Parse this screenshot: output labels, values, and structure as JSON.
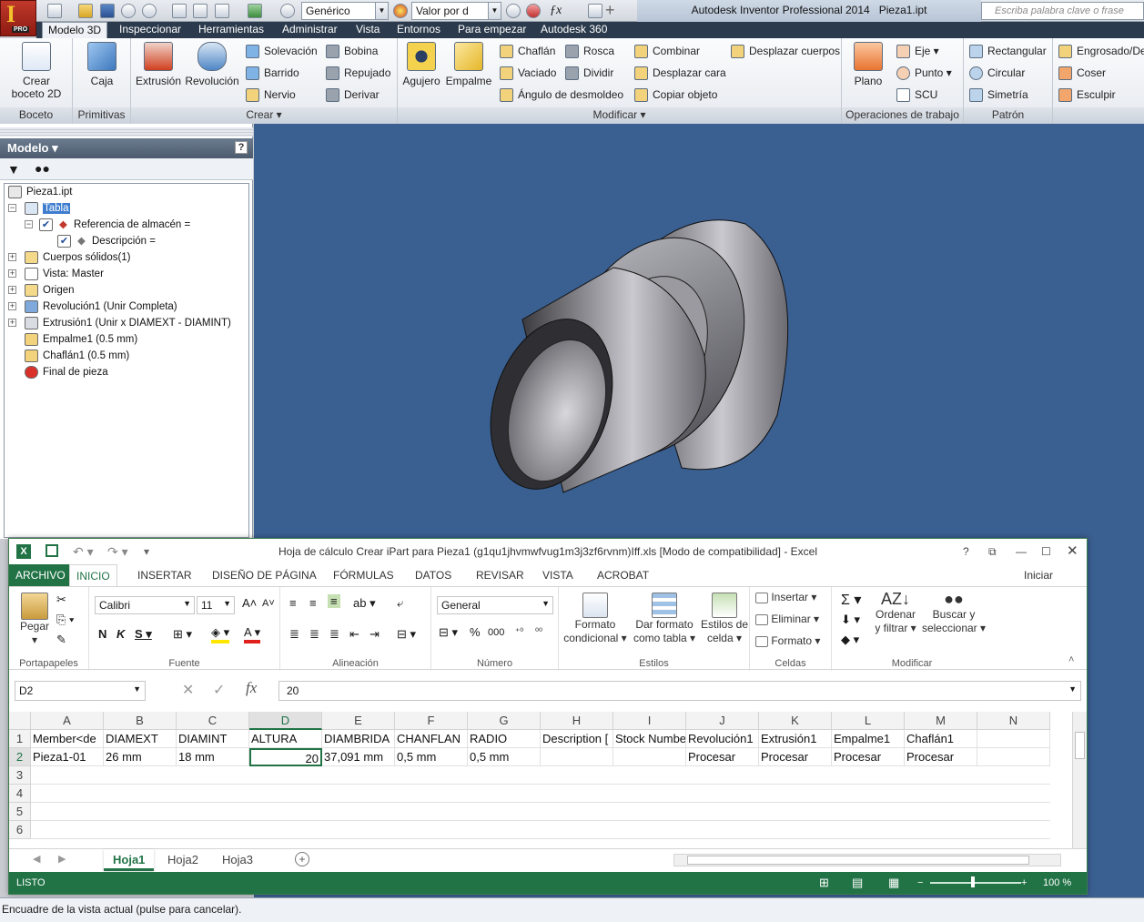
{
  "app": {
    "title": "Autodesk Inventor Professional 2014",
    "document": "Pieza1.ipt",
    "help_placeholder": "Escriba palabra clave o frase",
    "material_combo": "Genérico",
    "appearance_combo": "Valor por d",
    "status_text": "Encuadre de la vista actual (pulse para cancelar)."
  },
  "tabs": [
    "Modelo 3D",
    "Inspeccionar",
    "Herramientas",
    "Administrar",
    "Vista",
    "Entornos",
    "Para empezar",
    "Autodesk 360"
  ],
  "ribbon": {
    "boceto": {
      "label": "Boceto",
      "crear": "Crear",
      "boceto2d": "boceto 2D"
    },
    "primitivas": {
      "label": "Primitivas",
      "caja": "Caja"
    },
    "crear": {
      "label": "Crear",
      "extrusion": "Extrusión",
      "revolucion": "Revolución",
      "solevacion": "Solevación",
      "barrido": "Barrido",
      "nervio": "Nervio",
      "bobina": "Bobina",
      "repujado": "Repujado",
      "derivar": "Derivar"
    },
    "modificar": {
      "label": "Modificar",
      "agujero": "Agujero",
      "empalme": "Empalme",
      "chaflan": "Chaflán",
      "vaciado": "Vaciado",
      "angulo": "Ángulo de desmoldeo",
      "rosca": "Rosca",
      "dividir": "Dividir",
      "combinar": "Combinar",
      "desplazar_cara": "Desplazar cara",
      "copiar_objeto": "Copiar objeto",
      "desplazar_cuerpos": "Desplazar cuerpos"
    },
    "operaciones": {
      "label": "Operaciones de trabajo",
      "plano": "Plano",
      "eje": "Eje",
      "punto": "Punto",
      "scu": "SCU"
    },
    "patron": {
      "label": "Patrón",
      "rectangular": "Rectangular",
      "circular": "Circular",
      "simetria": "Simetría"
    },
    "superficie": {
      "engrosado": "Engrosado/De",
      "coser": "Coser",
      "esculpir": "Esculpir"
    }
  },
  "browser": {
    "title": "Modelo",
    "nodes": [
      "Pieza1.ipt",
      "Tabla",
      "Referencia de almacén =",
      "Descripción =",
      "Cuerpos sólidos(1)",
      "Vista: Master",
      "Origen",
      "Revolución1 (Unir Completa)",
      "Extrusión1 (Unir x DIAMEXT - DIAMINT)",
      "Empalme1 (0.5 mm)",
      "Chaflán1 (0.5 mm)",
      "Final de pieza"
    ]
  },
  "excel": {
    "title": "Hoja de cálculo Crear iPart para Pieza1 (g1qu1jhvmwfvug1m3j3zf6rvnm)Iff.xls  [Modo de compatibilidad] - Excel",
    "tabs": [
      "ARCHIVO",
      "INICIO",
      "INSERTAR",
      "DISEÑO DE PÁGINA",
      "FÓRMULAS",
      "DATOS",
      "REVISAR",
      "VISTA",
      "ACROBAT"
    ],
    "signin": "Iniciar sesión",
    "groups": {
      "portapapeles": "Portapapeles",
      "pegar": "Pegar",
      "fuente": "Fuente",
      "font": "Calibri",
      "size": "11",
      "alineacion": "Alineación",
      "numero": "Número",
      "format": "General",
      "estilos": "Estilos",
      "formato_cond1": "Formato",
      "formato_cond2": "condicional",
      "dar1": "Dar formato",
      "dar2": "como tabla",
      "est1": "Estilos de",
      "est2": "celda",
      "celdas": "Celdas",
      "insertar": "Insertar",
      "eliminar": "Eliminar",
      "formato": "Formato",
      "modificar": "Modificar",
      "ord1": "Ordenar",
      "ord2": "y filtrar",
      "bus1": "Buscar y",
      "bus2": "seleccionar"
    },
    "namebox": "D2",
    "formula": "20",
    "columns": [
      "A",
      "B",
      "C",
      "D",
      "E",
      "F",
      "G",
      "H",
      "I",
      "J",
      "K",
      "L",
      "M",
      "N"
    ],
    "rows": [
      "1",
      "2",
      "3",
      "4",
      "5",
      "6"
    ],
    "header_row": [
      "Member<de",
      "DIAMEXT",
      "DIAMINT",
      "ALTURA",
      "DIAMBRIDA",
      "CHANFLAN",
      "RADIO",
      "Description [",
      "Stock Numbe",
      "Revolución1",
      "Extrusión1",
      "Empalme1",
      "Chaflán1",
      ""
    ],
    "data_row": [
      "Pieza1-01",
      "26 mm",
      "18 mm",
      "20",
      "37,091 mm",
      "0,5 mm",
      "0,5 mm",
      "",
      "",
      "Procesar",
      "Procesar",
      "Procesar",
      "Procesar",
      ""
    ],
    "sheets": [
      "Hoja1",
      "Hoja2",
      "Hoja3"
    ],
    "status": "LISTO",
    "zoom": "100 %"
  }
}
